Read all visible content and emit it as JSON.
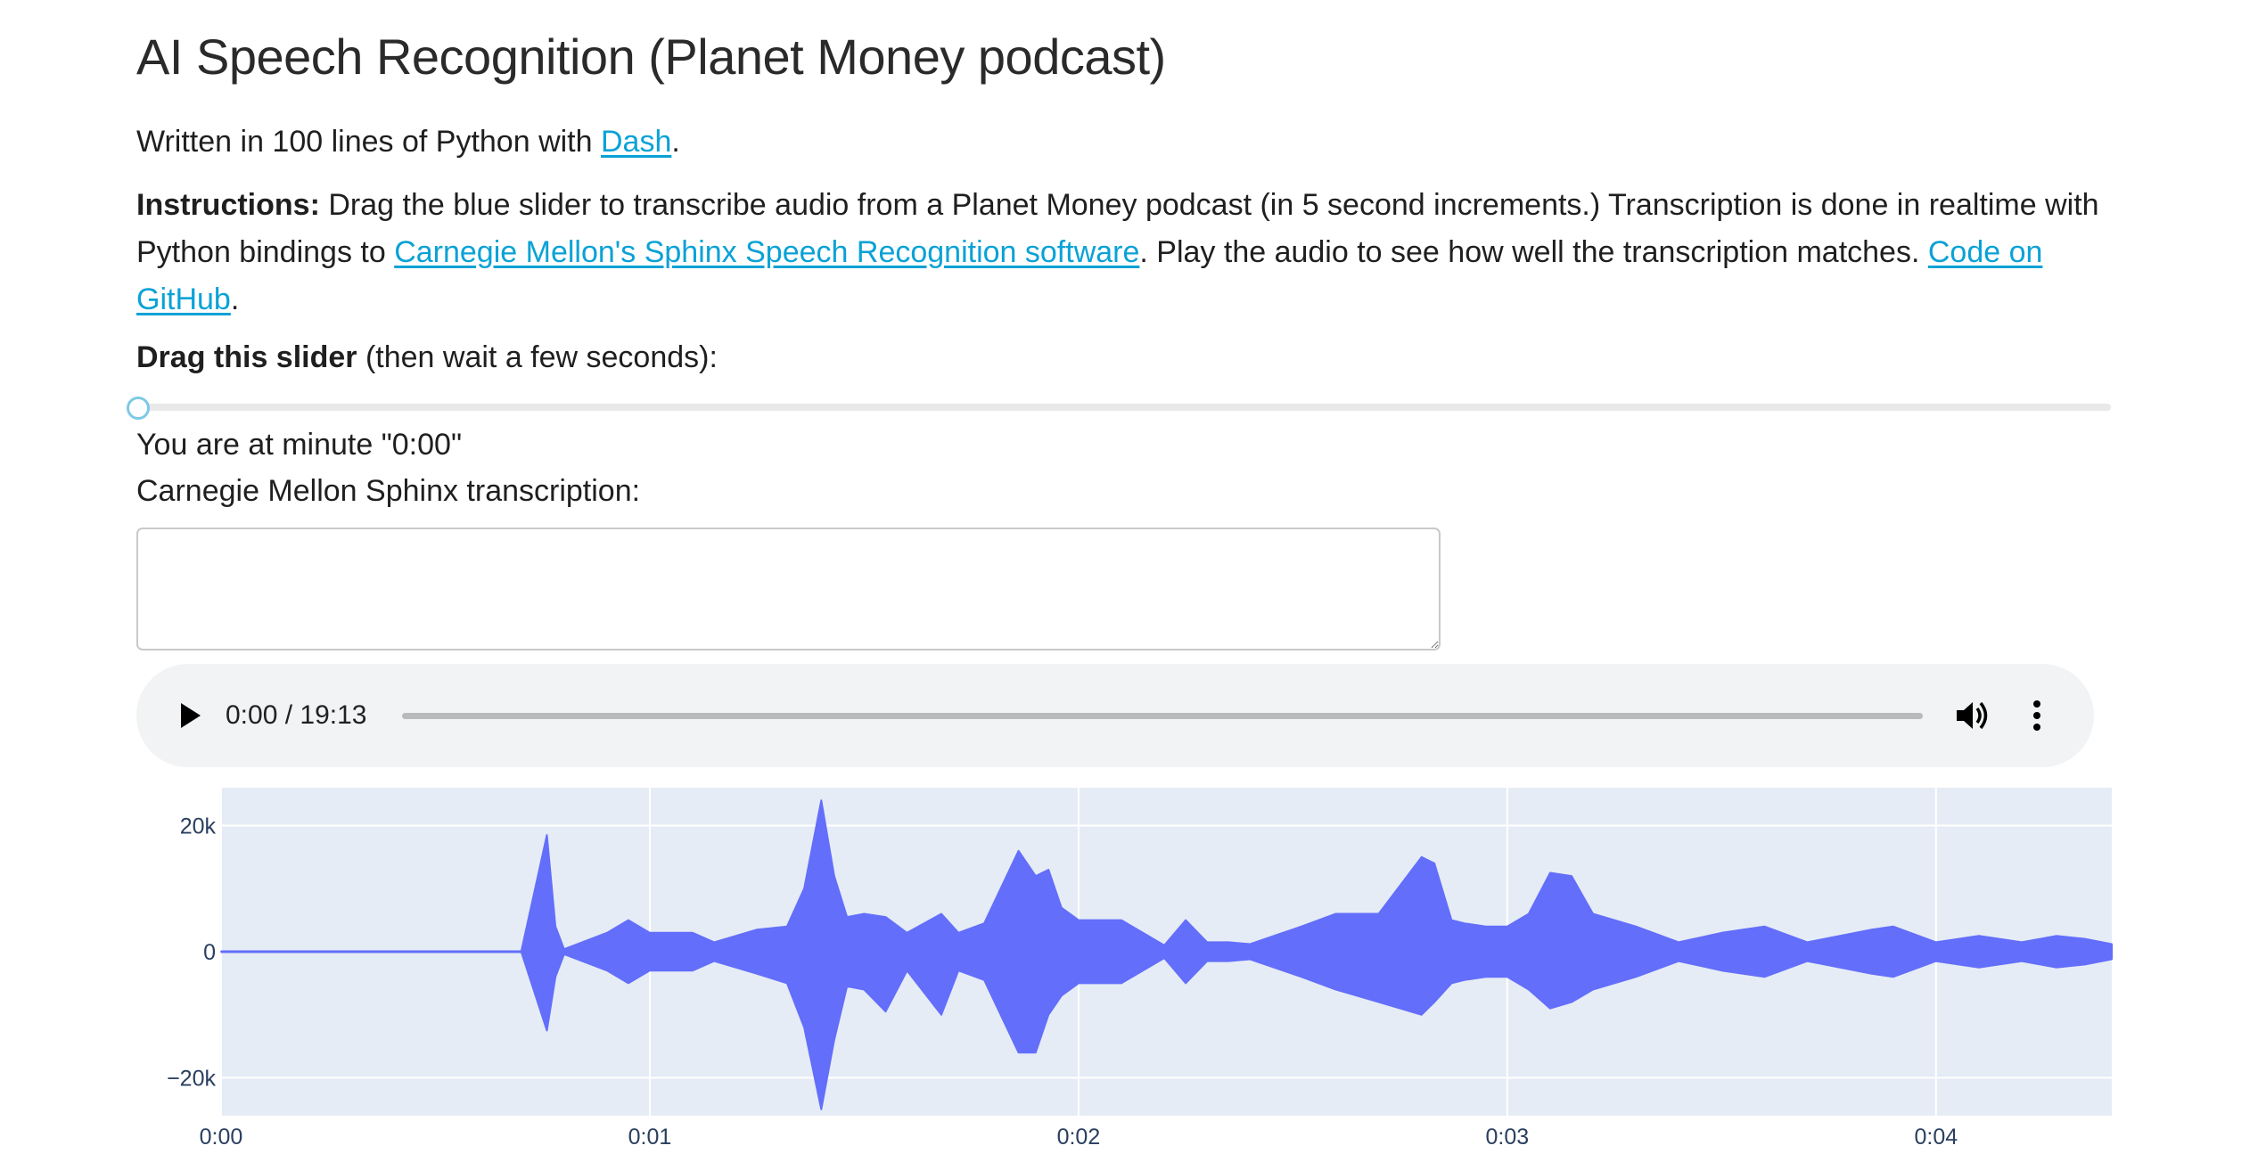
{
  "page": {
    "title": "AI Speech Recognition (Planet Money podcast)",
    "written": {
      "prefix": "Written in 100 lines of Python with ",
      "link_text": "Dash",
      "suffix": "."
    },
    "instructions": {
      "bold": "Instructions:",
      "part1": " Drag the blue slider to transcribe audio from a Planet Money podcast (in 5 second increments.) Transcription is done in realtime with Python bindings to ",
      "link1_text": "Carnegie Mellon's Sphinx Speech Recognition software",
      "part2": ". Play the audio to see how well the transcription matches. ",
      "link2_text": "Code on GitHub",
      "part3": "."
    },
    "drag_label": {
      "bold": "Drag this slider",
      "rest": " (then wait a few seconds):"
    },
    "slider": {
      "value_fraction": 0
    },
    "minute_text": "You are at minute \"0:00\"",
    "sphinx_label": "Carnegie Mellon Sphinx transcription:",
    "transcription_value": ""
  },
  "audio_player": {
    "time_display": "0:00 / 19:13",
    "progress_fraction": 0,
    "play_icon": "play-icon",
    "volume_icon": "volume-icon",
    "more_icon": "more-vertical-icon"
  },
  "colors": {
    "link": "#0aa2d6",
    "slider_handle": "#7ec9e6",
    "waveform": "#636efa",
    "plot_bg": "#e5ecf6",
    "player_bg": "#f1f3f4"
  },
  "chart_data": {
    "type": "area",
    "title": "",
    "xlabel": "",
    "ylabel": "",
    "xlim": [
      0,
      4.41
    ],
    "ylim": [
      -26000,
      26000
    ],
    "grid": true,
    "x_tick_labels": [
      "0:00",
      "0:01",
      "0:02",
      "0:03",
      "0:04"
    ],
    "x_tick_values": [
      0,
      1,
      2,
      3,
      4
    ],
    "y_tick_labels": [
      "20k",
      "0",
      "−20k"
    ],
    "y_tick_values": [
      20000,
      0,
      -20000
    ],
    "series": [
      {
        "x": [
          0.0,
          0.7,
          0.76,
          0.78,
          0.8,
          0.9,
          0.95,
          1.0,
          1.1,
          1.15,
          1.25,
          1.32,
          1.36,
          1.4,
          1.43,
          1.46,
          1.5,
          1.55,
          1.6,
          1.68,
          1.72,
          1.78,
          1.86,
          1.9,
          1.93,
          1.96,
          2.0,
          2.1,
          2.2,
          2.25,
          2.3,
          2.35,
          2.4,
          2.52,
          2.6,
          2.7,
          2.8,
          2.83,
          2.87,
          2.9,
          2.95,
          3.0,
          3.05,
          3.1,
          3.15,
          3.2,
          3.3,
          3.4,
          3.5,
          3.6,
          3.7,
          3.85,
          3.9,
          4.0,
          4.1,
          4.2,
          4.28,
          4.35,
          4.41
        ],
        "y_max": [
          0,
          0,
          18500,
          4000,
          400,
          3000,
          5000,
          3000,
          3000,
          1500,
          3500,
          4000,
          10000,
          24000,
          12000,
          5500,
          6000,
          5500,
          3000,
          6000,
          3000,
          4500,
          16000,
          12000,
          13000,
          7000,
          5000,
          5000,
          1000,
          5000,
          1500,
          1500,
          1200,
          4000,
          6000,
          6000,
          15000,
          14000,
          5000,
          4500,
          4000,
          4000,
          6000,
          12500,
          12000,
          6000,
          4000,
          1500,
          3000,
          4000,
          1500,
          3500,
          4000,
          1500,
          2500,
          1500,
          2500,
          2000,
          1200
        ],
        "y_min": [
          0,
          0,
          -12500,
          -4000,
          -400,
          -3000,
          -5000,
          -3000,
          -3000,
          -1500,
          -3500,
          -5000,
          -12000,
          -25000,
          -14000,
          -5500,
          -6000,
          -9500,
          -3000,
          -10000,
          -3000,
          -4500,
          -16000,
          -16000,
          -10000,
          -7000,
          -5000,
          -5000,
          -1000,
          -5000,
          -1500,
          -1500,
          -1200,
          -4000,
          -6000,
          -8000,
          -10000,
          -8000,
          -5000,
          -4500,
          -4000,
          -4000,
          -6000,
          -9000,
          -8000,
          -6000,
          -4000,
          -1500,
          -3000,
          -4000,
          -1500,
          -3500,
          -4000,
          -1500,
          -2500,
          -1500,
          -2500,
          -2000,
          -1200
        ]
      }
    ]
  }
}
